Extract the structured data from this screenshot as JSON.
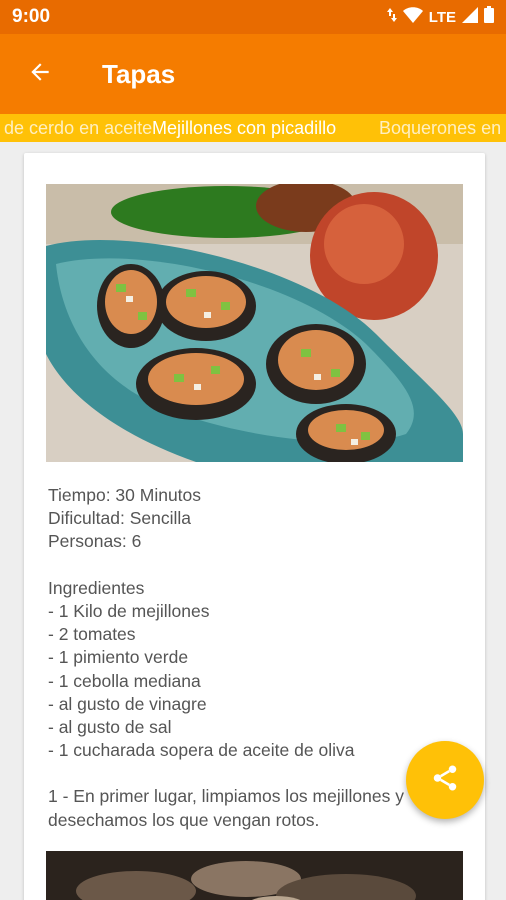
{
  "status_bar": {
    "time": "9:00",
    "network": "LTE"
  },
  "app_bar": {
    "title": "Tapas"
  },
  "tabs": [
    {
      "label": "Lomo de cerdo en aceite",
      "active": false
    },
    {
      "label": "Mejillones con picadillo",
      "active": true
    },
    {
      "label": "Boquerones en",
      "active": false
    }
  ],
  "recipe": {
    "time": "Tiempo: 30 Minutos",
    "difficulty": "Dificultad: Sencilla",
    "servings": "Personas: 6",
    "ingredients_heading": "Ingredientes",
    "ingredients": [
      "- 1 Kilo de mejillones",
      "- 2 tomates",
      "- 1 pimiento verde",
      "- 1 cebolla mediana",
      "- al gusto de vinagre",
      "- al gusto de sal",
      "- 1 cucharada sopera de aceite de oliva"
    ],
    "steps": [
      "1 - En primer lugar, limpiamos los mejillones y",
      "desechamos los que vengan rotos."
    ]
  },
  "icons": {
    "back": "arrow-left-icon",
    "share": "share-icon",
    "wifi": "wifi-icon",
    "signal": "signal-icon",
    "battery": "battery-icon",
    "data": "data-arrows-icon"
  },
  "colors": {
    "status_bar": "#e86b00",
    "app_bar": "#f57c00",
    "accent": "#ffc107"
  }
}
